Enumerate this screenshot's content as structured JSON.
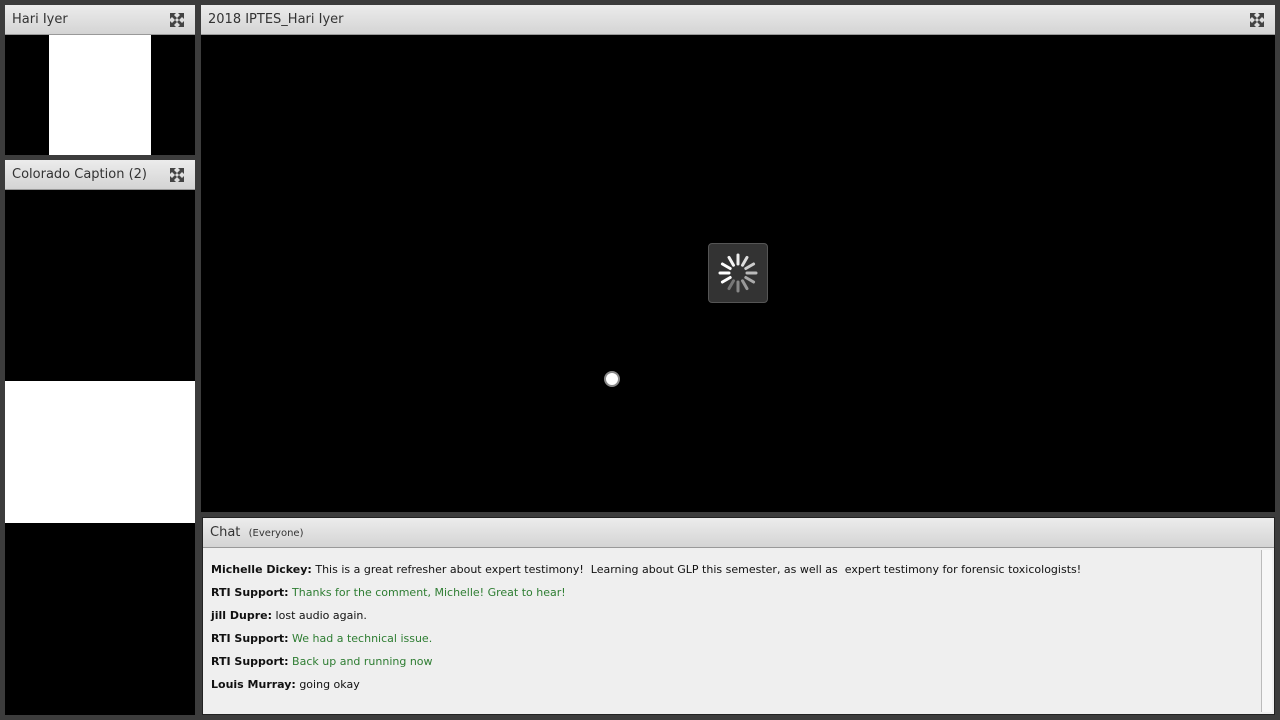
{
  "pods": {
    "camera": {
      "title": "Hari Iyer"
    },
    "caption": {
      "title": "Colorado Caption (2)"
    },
    "share": {
      "title": "2018 IPTES_Hari Iyer"
    }
  },
  "chat": {
    "title": "Chat",
    "audience": "(Everyone)",
    "messages": [
      {
        "sender": "Michelle Dickey:",
        "text": "This is a great refresher about expert testimony!  Learning about GLP this semester, as well as  expert testimony for forensic toxicologists!",
        "host": false
      },
      {
        "sender": "RTI Support:",
        "text": "Thanks for the comment, Michelle! Great to hear!",
        "host": true
      },
      {
        "sender": "jill Dupre:",
        "text": "lost audio again.",
        "host": false
      },
      {
        "sender": "RTI Support:",
        "text": "We had a technical issue.",
        "host": true
      },
      {
        "sender": "RTI Support:",
        "text": "Back up and running now",
        "host": true
      },
      {
        "sender": "Louis Murray:",
        "text": "going okay",
        "host": false
      }
    ]
  },
  "colors": {
    "host_text": "#2e7d32"
  }
}
